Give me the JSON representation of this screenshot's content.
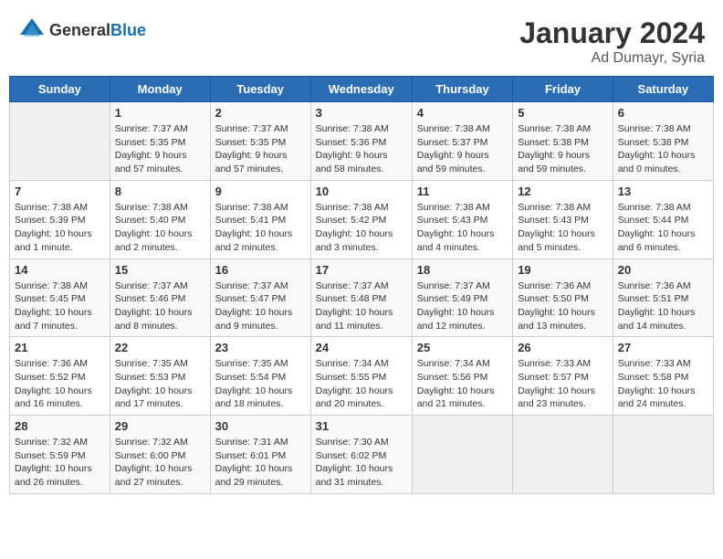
{
  "header": {
    "logo_general": "General",
    "logo_blue": "Blue",
    "month": "January 2024",
    "location": "Ad Dumayr, Syria"
  },
  "weekdays": [
    "Sunday",
    "Monday",
    "Tuesday",
    "Wednesday",
    "Thursday",
    "Friday",
    "Saturday"
  ],
  "weeks": [
    [
      {
        "day": "",
        "info": ""
      },
      {
        "day": "1",
        "info": "Sunrise: 7:37 AM\nSunset: 5:35 PM\nDaylight: 9 hours\nand 57 minutes."
      },
      {
        "day": "2",
        "info": "Sunrise: 7:37 AM\nSunset: 5:35 PM\nDaylight: 9 hours\nand 57 minutes."
      },
      {
        "day": "3",
        "info": "Sunrise: 7:38 AM\nSunset: 5:36 PM\nDaylight: 9 hours\nand 58 minutes."
      },
      {
        "day": "4",
        "info": "Sunrise: 7:38 AM\nSunset: 5:37 PM\nDaylight: 9 hours\nand 59 minutes."
      },
      {
        "day": "5",
        "info": "Sunrise: 7:38 AM\nSunset: 5:38 PM\nDaylight: 9 hours\nand 59 minutes."
      },
      {
        "day": "6",
        "info": "Sunrise: 7:38 AM\nSunset: 5:38 PM\nDaylight: 10 hours\nand 0 minutes."
      }
    ],
    [
      {
        "day": "7",
        "info": "Sunrise: 7:38 AM\nSunset: 5:39 PM\nDaylight: 10 hours\nand 1 minute."
      },
      {
        "day": "8",
        "info": "Sunrise: 7:38 AM\nSunset: 5:40 PM\nDaylight: 10 hours\nand 2 minutes."
      },
      {
        "day": "9",
        "info": "Sunrise: 7:38 AM\nSunset: 5:41 PM\nDaylight: 10 hours\nand 2 minutes."
      },
      {
        "day": "10",
        "info": "Sunrise: 7:38 AM\nSunset: 5:42 PM\nDaylight: 10 hours\nand 3 minutes."
      },
      {
        "day": "11",
        "info": "Sunrise: 7:38 AM\nSunset: 5:43 PM\nDaylight: 10 hours\nand 4 minutes."
      },
      {
        "day": "12",
        "info": "Sunrise: 7:38 AM\nSunset: 5:43 PM\nDaylight: 10 hours\nand 5 minutes."
      },
      {
        "day": "13",
        "info": "Sunrise: 7:38 AM\nSunset: 5:44 PM\nDaylight: 10 hours\nand 6 minutes."
      }
    ],
    [
      {
        "day": "14",
        "info": "Sunrise: 7:38 AM\nSunset: 5:45 PM\nDaylight: 10 hours\nand 7 minutes."
      },
      {
        "day": "15",
        "info": "Sunrise: 7:37 AM\nSunset: 5:46 PM\nDaylight: 10 hours\nand 8 minutes."
      },
      {
        "day": "16",
        "info": "Sunrise: 7:37 AM\nSunset: 5:47 PM\nDaylight: 10 hours\nand 9 minutes."
      },
      {
        "day": "17",
        "info": "Sunrise: 7:37 AM\nSunset: 5:48 PM\nDaylight: 10 hours\nand 11 minutes."
      },
      {
        "day": "18",
        "info": "Sunrise: 7:37 AM\nSunset: 5:49 PM\nDaylight: 10 hours\nand 12 minutes."
      },
      {
        "day": "19",
        "info": "Sunrise: 7:36 AM\nSunset: 5:50 PM\nDaylight: 10 hours\nand 13 minutes."
      },
      {
        "day": "20",
        "info": "Sunrise: 7:36 AM\nSunset: 5:51 PM\nDaylight: 10 hours\nand 14 minutes."
      }
    ],
    [
      {
        "day": "21",
        "info": "Sunrise: 7:36 AM\nSunset: 5:52 PM\nDaylight: 10 hours\nand 16 minutes."
      },
      {
        "day": "22",
        "info": "Sunrise: 7:35 AM\nSunset: 5:53 PM\nDaylight: 10 hours\nand 17 minutes."
      },
      {
        "day": "23",
        "info": "Sunrise: 7:35 AM\nSunset: 5:54 PM\nDaylight: 10 hours\nand 18 minutes."
      },
      {
        "day": "24",
        "info": "Sunrise: 7:34 AM\nSunset: 5:55 PM\nDaylight: 10 hours\nand 20 minutes."
      },
      {
        "day": "25",
        "info": "Sunrise: 7:34 AM\nSunset: 5:56 PM\nDaylight: 10 hours\nand 21 minutes."
      },
      {
        "day": "26",
        "info": "Sunrise: 7:33 AM\nSunset: 5:57 PM\nDaylight: 10 hours\nand 23 minutes."
      },
      {
        "day": "27",
        "info": "Sunrise: 7:33 AM\nSunset: 5:58 PM\nDaylight: 10 hours\nand 24 minutes."
      }
    ],
    [
      {
        "day": "28",
        "info": "Sunrise: 7:32 AM\nSunset: 5:59 PM\nDaylight: 10 hours\nand 26 minutes."
      },
      {
        "day": "29",
        "info": "Sunrise: 7:32 AM\nSunset: 6:00 PM\nDaylight: 10 hours\nand 27 minutes."
      },
      {
        "day": "30",
        "info": "Sunrise: 7:31 AM\nSunset: 6:01 PM\nDaylight: 10 hours\nand 29 minutes."
      },
      {
        "day": "31",
        "info": "Sunrise: 7:30 AM\nSunset: 6:02 PM\nDaylight: 10 hours\nand 31 minutes."
      },
      {
        "day": "",
        "info": ""
      },
      {
        "day": "",
        "info": ""
      },
      {
        "day": "",
        "info": ""
      }
    ]
  ]
}
